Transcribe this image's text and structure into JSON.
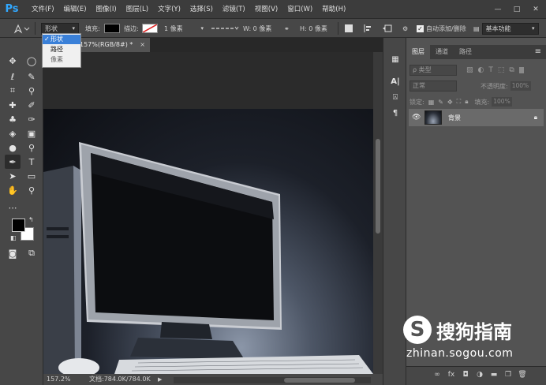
{
  "app": {
    "logo": "Ps"
  },
  "menu": [
    "文件(F)",
    "编辑(E)",
    "图像(I)",
    "图层(L)",
    "文字(Y)",
    "选择(S)",
    "滤镜(T)",
    "视图(V)",
    "窗口(W)",
    "帮助(H)"
  ],
  "window_controls": {
    "minimize": "—",
    "restore": "□",
    "close": "✕"
  },
  "options": {
    "mode_value": "形状",
    "fill_label": "填充:",
    "stroke_label": "描边:",
    "stroke_width": "1 像素",
    "w_label": "W: 0 像素",
    "h_label": "H: 0 像素",
    "auto_add_delete": "自动添加/删除",
    "workspace": "基本功能",
    "fill_color": "#000000",
    "stroke_color": "#ffffff"
  },
  "mode_dropdown": {
    "items": [
      "形状",
      "路径",
      "像素"
    ],
    "selected": "形状",
    "check_mark": "✓"
  },
  "document": {
    "tab_title": "157%(RGB/8#) *",
    "tab_close": "×"
  },
  "status": {
    "zoom": "157.2%",
    "doc_info": "文档:784.0K/784.0K",
    "arrow": "▶"
  },
  "panel": {
    "tabs": [
      "图层",
      "通道",
      "路径"
    ],
    "menu_icon": "≡",
    "search_placeholder": "ρ 类型",
    "blend_mode": "正常",
    "opacity_label": "不透明度:",
    "opacity_value": "100%",
    "lock_label": "锁定:",
    "fill_label": "填充:",
    "fill_value": "100%",
    "layer_name": "背景",
    "footer_icons": [
      "∞",
      "fx",
      "◘",
      "◑",
      "▬",
      "❐",
      "🗑"
    ]
  },
  "watermark": {
    "symbol": "S",
    "text": "搜狗指南",
    "url": "zhinan.sogou.com"
  },
  "colors": {
    "menubar": "#3c3c3c",
    "workspace_bg": "#535353",
    "accent_blue": "#31a8ff",
    "dropdown_highlight": "#3a80d8"
  }
}
